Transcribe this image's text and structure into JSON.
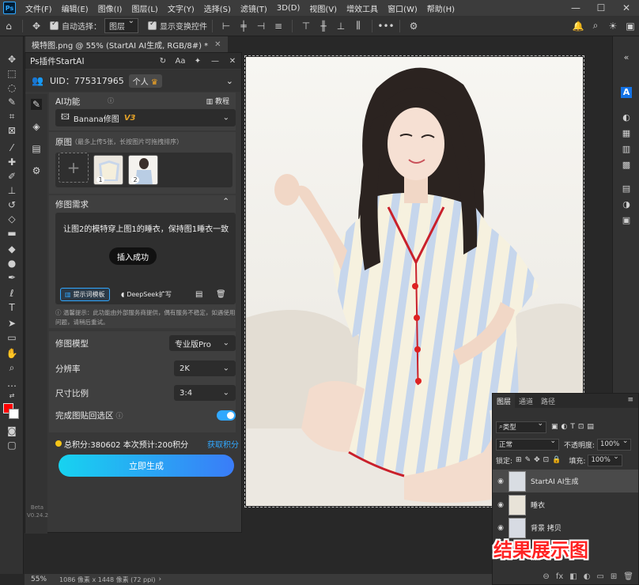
{
  "app": {
    "logo": "Ps",
    "menu": [
      "文件(F)",
      "编辑(E)",
      "图像(I)",
      "图层(L)",
      "文字(Y)",
      "选择(S)",
      "滤镜(T)",
      "3D(D)",
      "视图(V)",
      "增效工具",
      "窗口(W)",
      "帮助(H)"
    ],
    "window_controls": [
      "—",
      "☐",
      "✕"
    ]
  },
  "options_bar": {
    "auto_select_label": "自动选择：",
    "auto_select_value": "图层",
    "show_transform_label": "显示变换控件",
    "more": "•••"
  },
  "document": {
    "tab_title": "模特图.png @ 55% (StartAI AI生成, RGB/8#) *",
    "tab_close": "✕"
  },
  "plugin": {
    "title": "Ps插件StartAI",
    "uid_label": "UID：775317965",
    "account_badge": "个人",
    "ai_function_label": "AI功能",
    "tutorial_label": "教程",
    "model_select": "Banana修图",
    "model_version": "V3",
    "original_label": "原图",
    "original_hint": "（最多上传5张，长按图片可拖拽排序）",
    "thumb_add": "+",
    "thumbs": [
      "1",
      "2"
    ],
    "edit_need_label": "修图需求",
    "prompt_text": "让图2的模特穿上图1的睡衣，保持图1睡衣一致",
    "toast": "插入成功",
    "template_btn": "提示词模板",
    "deepseek_btn": "DeepSeek扩写",
    "tip": "温馨提示：此功能由外部服务商提供，偶有服务不稳定，如遇使用问题，请稍后重试。",
    "model_row_label": "修图模型",
    "model_row_value": "专业版Pro",
    "resolution_label": "分辨率",
    "resolution_value": "2K",
    "ratio_label": "尺寸比例",
    "ratio_value": "3:4",
    "paste_back_label": "完成图贴回选区",
    "paste_back_on": true,
    "points_text": "总积分:380602  本次预计:200积分",
    "get_points": "获取积分",
    "generate_btn": "立即生成",
    "version": "Beta V0.24.2"
  },
  "layers_panel": {
    "tabs": [
      "图层",
      "通道",
      "路径"
    ],
    "filter_label": "类型",
    "blend_mode": "正常",
    "opacity_label": "不透明度:",
    "opacity_value": "100%",
    "lock_label": "锁定:",
    "fill_label": "填充:",
    "fill_value": "100%",
    "layers": [
      {
        "name": "StartAI AI生成",
        "selected": true
      },
      {
        "name": "睡衣",
        "selected": false
      },
      {
        "name": "背景 拷贝",
        "selected": false
      }
    ],
    "footer_icons": [
      "⊖",
      "fx",
      "◧",
      "◐",
      "▭",
      "⊞",
      "🗑"
    ]
  },
  "status_bar": {
    "zoom": "55%",
    "doc_info": "1086 像素 x 1448 像素 (72 ppi)"
  },
  "overlay": {
    "caption": "结果展示图"
  },
  "colors": {
    "accent": "#31a8ff",
    "foreground_color": "#ff0000",
    "background_color": "#ffffff",
    "generate_gradient_start": "#17d3f0",
    "generate_gradient_end": "#3a7cf8"
  }
}
